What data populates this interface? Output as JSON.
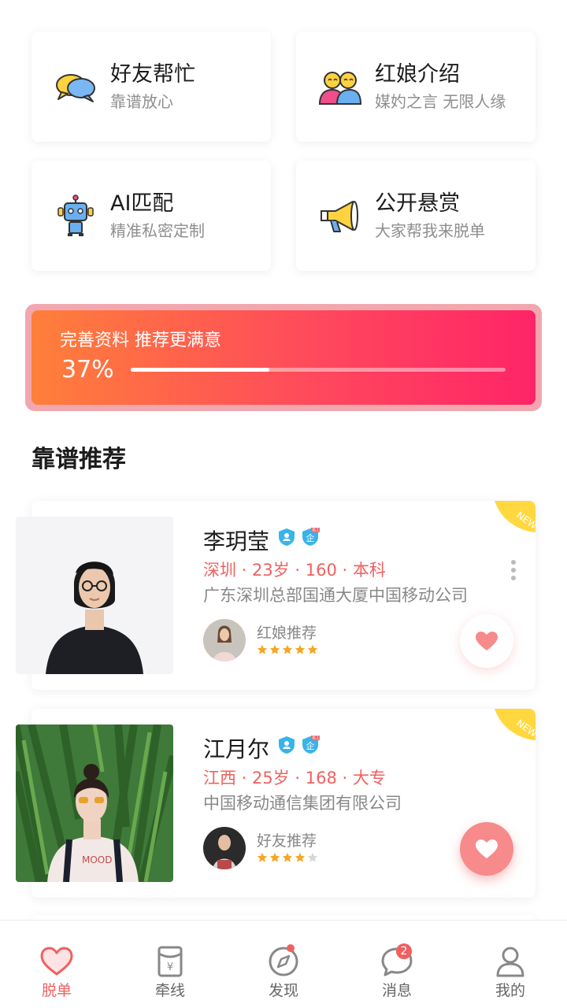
{
  "features": [
    {
      "title": "好友帮忙",
      "subtitle": "靠谱放心",
      "icon": "chat-bubbles-icon"
    },
    {
      "title": "红娘介绍",
      "subtitle": "媒妁之言 无限人缘",
      "icon": "matchmaker-icon"
    },
    {
      "title": "AI匹配",
      "subtitle": "精准私密定制",
      "icon": "robot-icon"
    },
    {
      "title": "公开悬赏",
      "subtitle": "大家帮我来脱单",
      "icon": "megaphone-icon"
    }
  ],
  "profile_progress": {
    "title": "完善资料 推荐更满意",
    "percent_label": "37%",
    "fraction": 0.37
  },
  "section_title": "靠谱推荐",
  "recommendations": [
    {
      "name": "李玥莹",
      "info": "深圳 · 23岁 · 160 · 本科",
      "company": "广东深圳总部国通大厦中国移动公司",
      "recommender_label": "红娘推荐",
      "rating": 5,
      "new_badge": "NEW",
      "liked": false
    },
    {
      "name": "江月尔",
      "info": "江西 · 25岁 · 168 · 大专",
      "company": "中国移动通信集团有限公司",
      "recommender_label": "好友推荐",
      "rating": 4,
      "new_badge": "NEW",
      "liked": true
    }
  ],
  "badge_small_text": "员工",
  "badge_enterprise_char": "企",
  "nav": [
    {
      "label": "脱单",
      "icon": "heart-icon",
      "active": true
    },
    {
      "label": "牵线",
      "icon": "red-envelope-icon",
      "active": false
    },
    {
      "label": "发现",
      "icon": "compass-icon",
      "active": false,
      "dot": true
    },
    {
      "label": "消息",
      "icon": "message-icon",
      "active": false,
      "count": "2"
    },
    {
      "label": "我的",
      "icon": "person-icon",
      "active": false
    }
  ],
  "colors": {
    "accent": "#f06060",
    "gradient_start": "#ff7f3a",
    "gradient_end": "#ff2468",
    "badge_blue": "#3ab3e8",
    "star_orange": "#f5a623",
    "new_yellow": "#ffd840"
  }
}
